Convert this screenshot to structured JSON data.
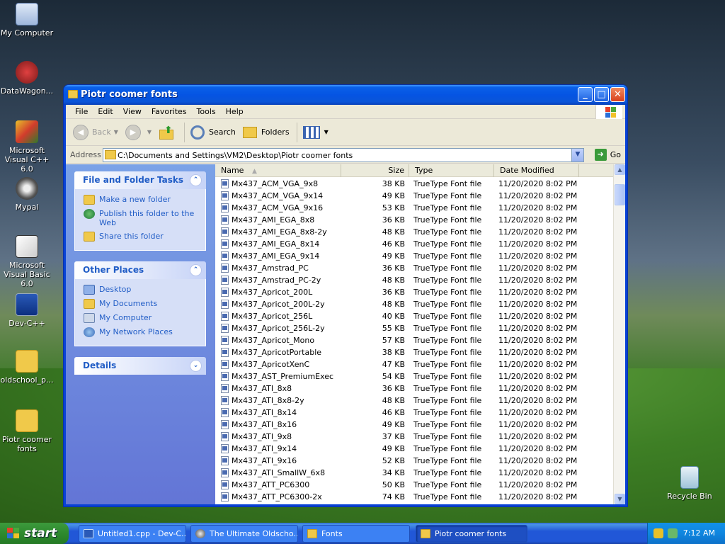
{
  "desktop_icons": [
    {
      "label": "My Computer",
      "icon": "computer-icon"
    },
    {
      "label": "DataWagon...",
      "icon": "datawagon-icon"
    },
    {
      "label": "Microsoft Visual C++ 6.0",
      "icon": "visual-cpp-icon"
    },
    {
      "label": "Mypal",
      "icon": "mypal-icon"
    },
    {
      "label": "Microsoft Visual Basic 6.0",
      "icon": "visual-basic-icon"
    },
    {
      "label": "Dev-C++",
      "icon": "devcpp-icon"
    },
    {
      "label": "oldschool_p...",
      "icon": "zip-folder-icon"
    },
    {
      "label": "Piotr coomer fonts",
      "icon": "folder-icon"
    },
    {
      "label": "Recycle Bin",
      "icon": "recycle-bin-icon"
    }
  ],
  "window": {
    "title": "Piotr coomer fonts",
    "minimize": "_",
    "maximize": "□",
    "close": "✕"
  },
  "menu": [
    "File",
    "Edit",
    "View",
    "Favorites",
    "Tools",
    "Help"
  ],
  "toolbar": {
    "back": "Back",
    "search": "Search",
    "folders": "Folders"
  },
  "address": {
    "label": "Address",
    "path": "C:\\Documents and Settings\\VM2\\Desktop\\Piotr coomer fonts",
    "go": "Go"
  },
  "tasks": {
    "file_folder": {
      "title": "File and Folder Tasks",
      "links": [
        "Make a new folder",
        "Publish this folder to the Web",
        "Share this folder"
      ]
    },
    "other_places": {
      "title": "Other Places",
      "links": [
        "Desktop",
        "My Documents",
        "My Computer",
        "My Network Places"
      ]
    },
    "details": {
      "title": "Details"
    }
  },
  "columns": {
    "name": "Name",
    "size": "Size",
    "type": "Type",
    "date": "Date Modified"
  },
  "files": [
    {
      "name": "Mx437_ACM_VGA_9x8",
      "size": "38 KB",
      "type": "TrueType Font file",
      "date": "11/20/2020 8:02 PM"
    },
    {
      "name": "Mx437_ACM_VGA_9x14",
      "size": "49 KB",
      "type": "TrueType Font file",
      "date": "11/20/2020 8:02 PM"
    },
    {
      "name": "Mx437_ACM_VGA_9x16",
      "size": "53 KB",
      "type": "TrueType Font file",
      "date": "11/20/2020 8:02 PM"
    },
    {
      "name": "Mx437_AMI_EGA_8x8",
      "size": "36 KB",
      "type": "TrueType Font file",
      "date": "11/20/2020 8:02 PM"
    },
    {
      "name": "Mx437_AMI_EGA_8x8-2y",
      "size": "48 KB",
      "type": "TrueType Font file",
      "date": "11/20/2020 8:02 PM"
    },
    {
      "name": "Mx437_AMI_EGA_8x14",
      "size": "46 KB",
      "type": "TrueType Font file",
      "date": "11/20/2020 8:02 PM"
    },
    {
      "name": "Mx437_AMI_EGA_9x14",
      "size": "49 KB",
      "type": "TrueType Font file",
      "date": "11/20/2020 8:02 PM"
    },
    {
      "name": "Mx437_Amstrad_PC",
      "size": "36 KB",
      "type": "TrueType Font file",
      "date": "11/20/2020 8:02 PM"
    },
    {
      "name": "Mx437_Amstrad_PC-2y",
      "size": "48 KB",
      "type": "TrueType Font file",
      "date": "11/20/2020 8:02 PM"
    },
    {
      "name": "Mx437_Apricot_200L",
      "size": "36 KB",
      "type": "TrueType Font file",
      "date": "11/20/2020 8:02 PM"
    },
    {
      "name": "Mx437_Apricot_200L-2y",
      "size": "48 KB",
      "type": "TrueType Font file",
      "date": "11/20/2020 8:02 PM"
    },
    {
      "name": "Mx437_Apricot_256L",
      "size": "40 KB",
      "type": "TrueType Font file",
      "date": "11/20/2020 8:02 PM"
    },
    {
      "name": "Mx437_Apricot_256L-2y",
      "size": "55 KB",
      "type": "TrueType Font file",
      "date": "11/20/2020 8:02 PM"
    },
    {
      "name": "Mx437_Apricot_Mono",
      "size": "57 KB",
      "type": "TrueType Font file",
      "date": "11/20/2020 8:02 PM"
    },
    {
      "name": "Mx437_ApricotPortable",
      "size": "38 KB",
      "type": "TrueType Font file",
      "date": "11/20/2020 8:02 PM"
    },
    {
      "name": "Mx437_ApricotXenC",
      "size": "47 KB",
      "type": "TrueType Font file",
      "date": "11/20/2020 8:02 PM"
    },
    {
      "name": "Mx437_AST_PremiumExec",
      "size": "54 KB",
      "type": "TrueType Font file",
      "date": "11/20/2020 8:02 PM"
    },
    {
      "name": "Mx437_ATI_8x8",
      "size": "36 KB",
      "type": "TrueType Font file",
      "date": "11/20/2020 8:02 PM"
    },
    {
      "name": "Mx437_ATI_8x8-2y",
      "size": "48 KB",
      "type": "TrueType Font file",
      "date": "11/20/2020 8:02 PM"
    },
    {
      "name": "Mx437_ATI_8x14",
      "size": "46 KB",
      "type": "TrueType Font file",
      "date": "11/20/2020 8:02 PM"
    },
    {
      "name": "Mx437_ATI_8x16",
      "size": "49 KB",
      "type": "TrueType Font file",
      "date": "11/20/2020 8:02 PM"
    },
    {
      "name": "Mx437_ATI_9x8",
      "size": "37 KB",
      "type": "TrueType Font file",
      "date": "11/20/2020 8:02 PM"
    },
    {
      "name": "Mx437_ATI_9x14",
      "size": "49 KB",
      "type": "TrueType Font file",
      "date": "11/20/2020 8:02 PM"
    },
    {
      "name": "Mx437_ATI_9x16",
      "size": "52 KB",
      "type": "TrueType Font file",
      "date": "11/20/2020 8:02 PM"
    },
    {
      "name": "Mx437_ATI_SmallW_6x8",
      "size": "34 KB",
      "type": "TrueType Font file",
      "date": "11/20/2020 8:02 PM"
    },
    {
      "name": "Mx437_ATT_PC6300",
      "size": "50 KB",
      "type": "TrueType Font file",
      "date": "11/20/2020 8:02 PM"
    },
    {
      "name": "Mx437_ATT_PC6300-2x",
      "size": "74 KB",
      "type": "TrueType Font file",
      "date": "11/20/2020 8:02 PM"
    }
  ],
  "taskbar": {
    "start": "start",
    "tasks": [
      {
        "label": "Untitled1.cpp - Dev-C...",
        "icon": "devcpp-icon",
        "active": false
      },
      {
        "label": "The Ultimate Oldscho...",
        "icon": "mypal-icon",
        "active": false
      },
      {
        "label": "Fonts",
        "icon": "folder-icon",
        "active": false
      },
      {
        "label": "Piotr coomer fonts",
        "icon": "folder-icon",
        "active": true
      }
    ],
    "clock": "7:12 AM"
  }
}
